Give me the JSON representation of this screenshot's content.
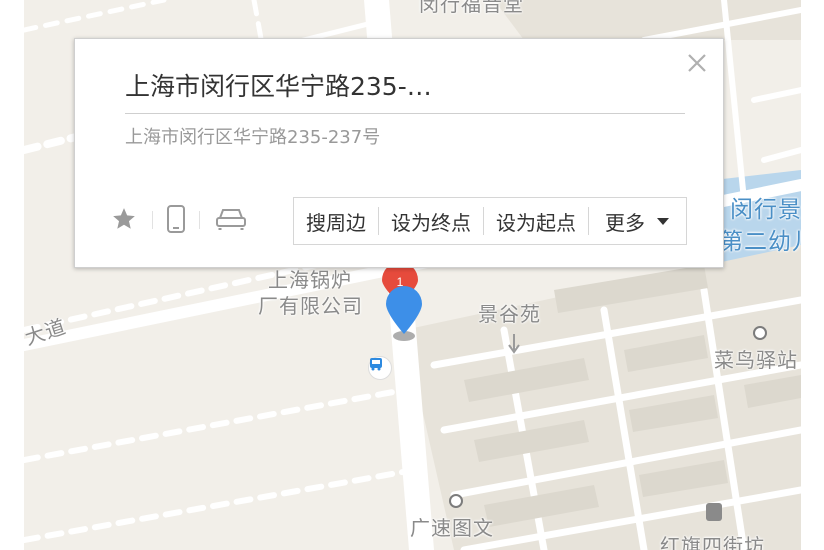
{
  "map": {
    "background": "#f2efe9",
    "block_color": "#e7e3da",
    "road_color": "#ffffff",
    "water_color": "#b9d6ec",
    "labels": {
      "top": "闵行福音堂",
      "company": "上海锅炉",
      "company_line2": "厂有限公司",
      "district": "景谷苑",
      "road": "大道",
      "school": "闵行景",
      "school_line2": "第二幼儿",
      "station": "菜鸟驿站",
      "poi_bottom": "广速图文",
      "street": "红旗四街坊"
    },
    "markers": {
      "selected_color": "#3d8fe8",
      "other_color": "#e64b3c",
      "bus_icon": "bus-icon"
    }
  },
  "popup": {
    "title": "上海市闵行区华宁路235-…",
    "address": "上海市闵行区华宁路235-237号",
    "close_icon": "close-icon",
    "icons": [
      "star-icon",
      "phone-icon",
      "car-icon"
    ],
    "actions": {
      "nearby": "搜周边",
      "set_end": "设为终点",
      "set_start": "设为起点",
      "more": "更多"
    }
  }
}
